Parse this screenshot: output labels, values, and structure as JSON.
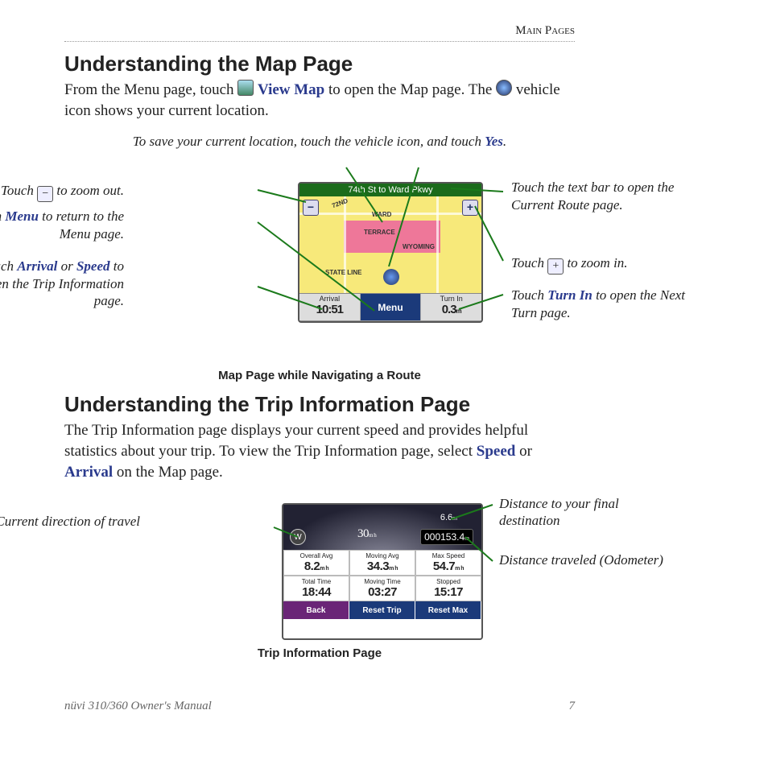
{
  "header": {
    "section": "Main Pages"
  },
  "section1": {
    "title": "Understanding the Map Page",
    "intro_p1": "From the Menu page, touch ",
    "view_map": "View Map",
    "intro_p2": " to open the Map page. The ",
    "intro_p3": " vehicle icon shows your current location.",
    "center_note_p1": "To save your current location, touch the vehicle icon, and touch ",
    "center_note_term": "Yes",
    "center_note_p2": ".",
    "callouts": {
      "zoom_out": {
        "pre": "Touch ",
        "post": " to zoom out."
      },
      "menu": {
        "pre": "Touch ",
        "term": "Menu",
        "post": " to return to the Menu page."
      },
      "trip": {
        "pre": "Touch ",
        "t1": "Arrival",
        "mid": " or ",
        "t2": "Speed",
        "post": " to open the Trip Information page."
      },
      "textbar": "Touch the text bar to open the Current Route page.",
      "zoom_in": {
        "pre": "Touch ",
        "post": " to zoom in."
      },
      "turn_in": {
        "pre": "Touch ",
        "term": "Turn In",
        "post": " to open the Next Turn page."
      }
    },
    "map_screen": {
      "title": "74th St to Ward Pkwy",
      "labels": {
        "ward": "WARD",
        "terrace": "TERRACE",
        "wyoming": "WYOMING",
        "state_line": "STATE LINE",
        "seventy_second": "72ND"
      },
      "bottom": {
        "arrival_label": "Arrival",
        "arrival_val": "10:51",
        "menu": "Menu",
        "turnin_label": "Turn In",
        "turnin_val": "0.3",
        "turnin_unit": "m"
      }
    },
    "fig_caption": "Map Page while Navigating a Route"
  },
  "section2": {
    "title": "Understanding the Trip Information Page",
    "intro_p1": "The Trip Information page displays your current speed and provides helpful statistics about your trip. To view the Trip Information page, select ",
    "term1": "Speed",
    "mid": " or ",
    "term2": "Arrival",
    "intro_p2": " on the Map page.",
    "callouts": {
      "direction": "Current direction of travel",
      "dist_final": "Distance to your final destination",
      "odo": "Distance traveled (Odometer)"
    },
    "trip_screen": {
      "compass": "W",
      "speed": "30",
      "speed_unit": "m h",
      "dist": "6.6",
      "dist_unit": "m",
      "odo": "000153.4",
      "odo_unit": "m",
      "stats": [
        {
          "label": "Overall Avg",
          "value": "8.2",
          "unit": "m h"
        },
        {
          "label": "Moving Avg",
          "value": "34.3",
          "unit": "m h"
        },
        {
          "label": "Max Speed",
          "value": "54.7",
          "unit": "m h"
        },
        {
          "label": "Total Time",
          "value": "18:44"
        },
        {
          "label": "Moving Time",
          "value": "03:27"
        },
        {
          "label": "Stopped",
          "value": "15:17"
        }
      ],
      "buttons": {
        "back": "Back",
        "reset_trip": "Reset Trip",
        "reset_max": "Reset Max"
      }
    },
    "fig_caption": "Trip Information Page"
  },
  "footer": {
    "manual": "nüvi 310/360 Owner's Manual",
    "page": "7"
  }
}
